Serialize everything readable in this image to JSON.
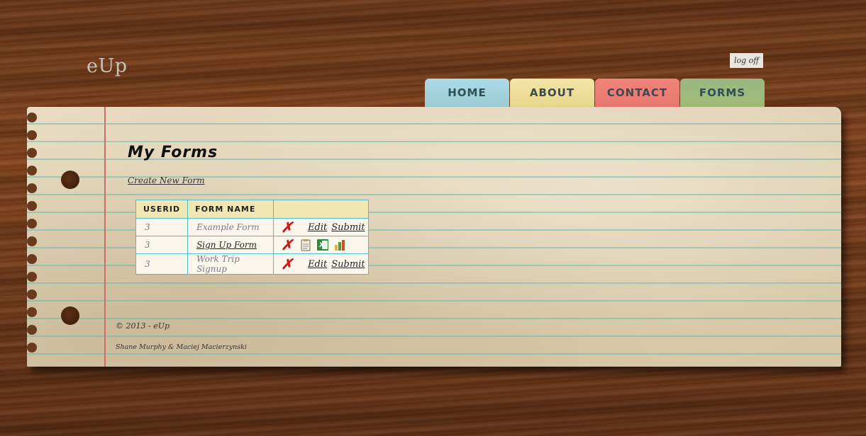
{
  "app": {
    "logo": "eUp"
  },
  "header": {
    "logoff_label": "log off"
  },
  "nav": {
    "home": "HOME",
    "about": "ABOUT",
    "contact": "CONTACT",
    "forms": "FORMS"
  },
  "main": {
    "title": "My Forms",
    "create_link": "Create New Form",
    "table": {
      "headers": [
        "USERID",
        "FORM NAME",
        ""
      ],
      "rows": [
        {
          "userid": "3",
          "form_name": "Example Form",
          "edit": "Edit",
          "submit": "Submit"
        },
        {
          "userid": "3",
          "form_name": "Sign Up Form",
          "edit": "",
          "submit": ""
        },
        {
          "userid": "3",
          "form_name": "Work Trip Signup",
          "edit": "Edit",
          "submit": "Submit"
        }
      ]
    }
  },
  "footer": {
    "copyright": "© 2013 - eUp",
    "authors": "Shane Murphy & Maciej Macierzynski"
  },
  "icons": [
    "delete-icon",
    "clipboard-icon",
    "excel-csv-icon",
    "bar-chart-icon"
  ],
  "colors": {
    "home_tab": "#a9dbe8",
    "about_tab": "#f2e5a6",
    "contact_tab": "#f0837a",
    "forms_tab": "#99b884",
    "table_border": "#4bbfc8",
    "delete": "#c91d1d"
  }
}
